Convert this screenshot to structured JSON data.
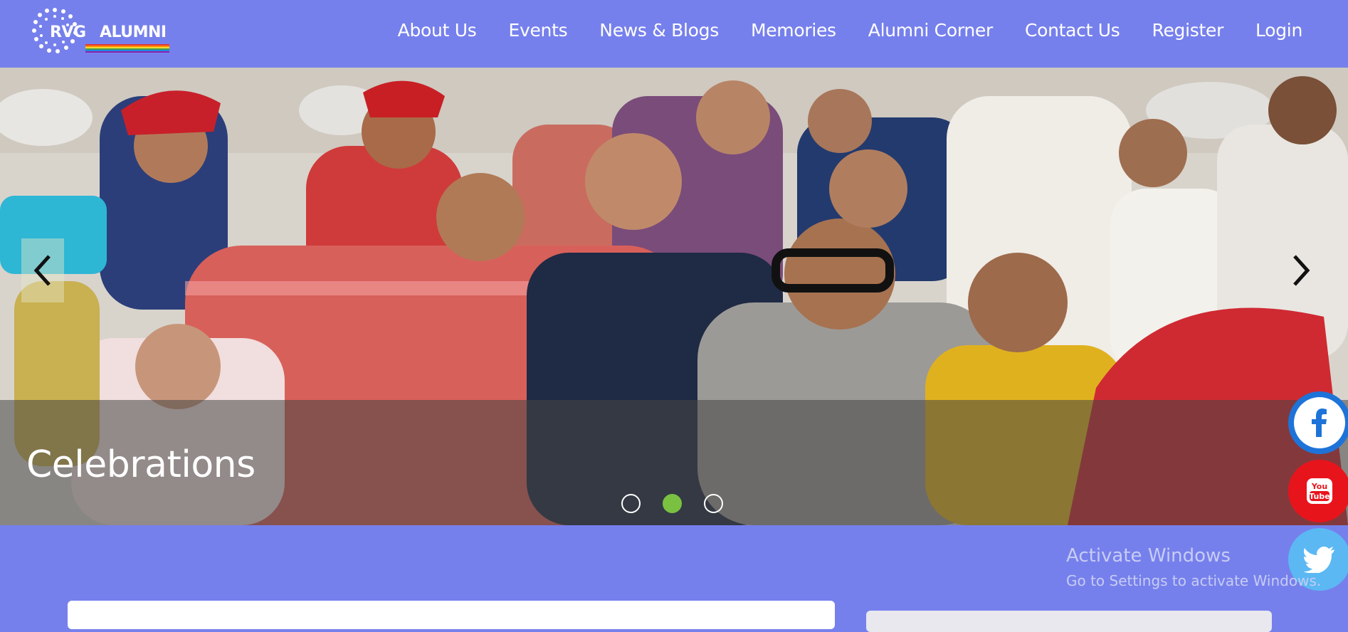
{
  "header": {
    "logo": {
      "text_left": "RVG",
      "text_right": "ALUMNI",
      "rainbow_colors": [
        "#e53935",
        "#fb8c00",
        "#fdd835",
        "#43a047",
        "#1e88e5",
        "#8e24aa"
      ]
    },
    "nav": [
      "About Us",
      "Events",
      "News & Blogs",
      "Memories",
      "Alumni Corner",
      "Contact Us",
      "Register",
      "Login"
    ]
  },
  "hero": {
    "caption": "Celebrations",
    "slides": 3,
    "active_slide": 2,
    "accent_color": "#7ac142"
  },
  "social": {
    "facebook": {
      "icon": "facebook-icon",
      "color": "#1e73d8"
    },
    "youtube": {
      "icon": "youtube-icon",
      "label": "You Tube",
      "color": "#e8141c"
    },
    "twitter": {
      "icon": "twitter-icon",
      "color": "#5bb8f3"
    }
  },
  "watermark": {
    "title": "Activate Windows",
    "subtitle": "Go to Settings to activate Windows."
  },
  "theme": {
    "background": "#7680ec"
  }
}
